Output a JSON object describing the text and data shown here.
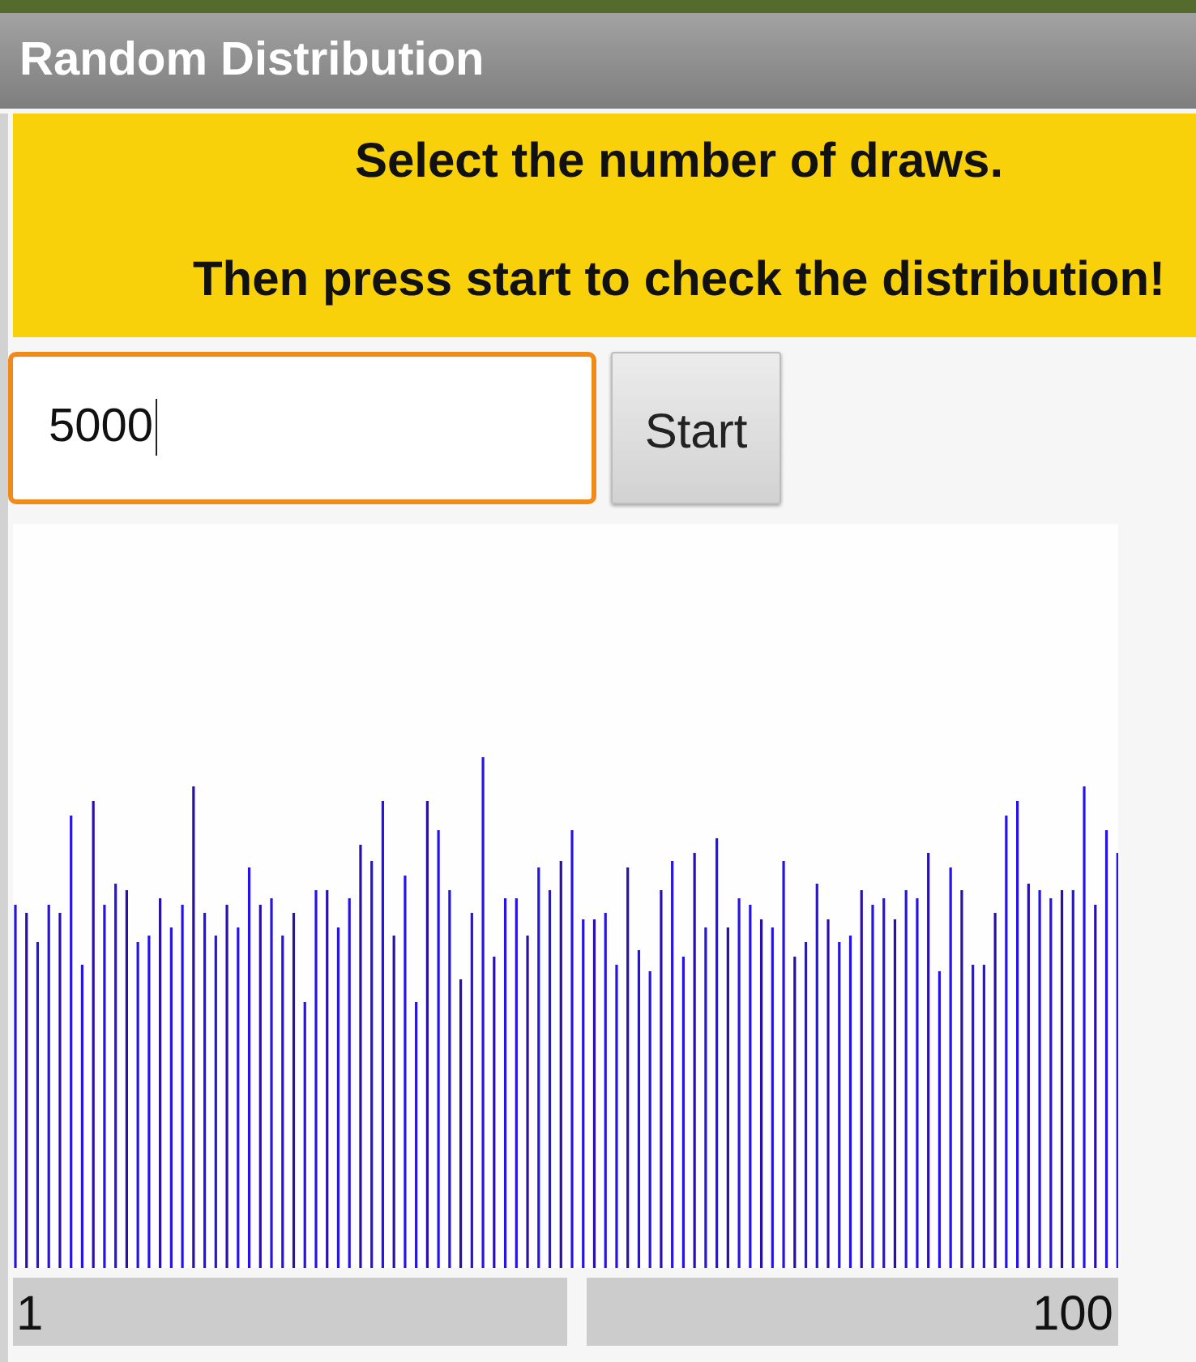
{
  "window": {
    "title": "Random Distribution"
  },
  "banner": {
    "lines": [
      "Select the number of draws.",
      "Then press start to check the distribution!"
    ]
  },
  "draws_field": {
    "value": "5000",
    "focused": true
  },
  "start_button": {
    "label": "Start"
  },
  "histogram": {
    "range_labels": [
      "1",
      "100"
    ]
  }
}
